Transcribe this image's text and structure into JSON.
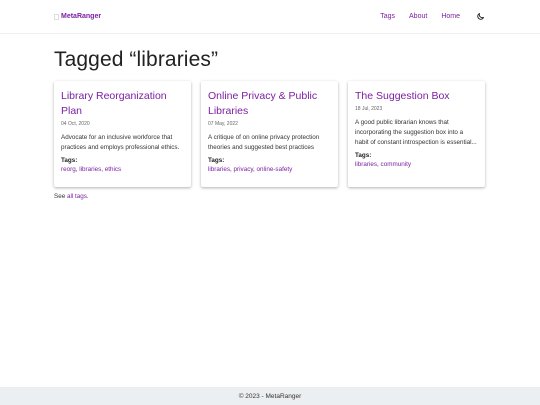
{
  "header": {
    "brand": "MetaRanger",
    "nav": [
      "Tags",
      "About",
      "Home"
    ],
    "theme_icon": "moon-icon"
  },
  "main": {
    "title": "Tagged “libraries”",
    "cards": [
      {
        "title": "Library Reorganization Plan",
        "date": "04 Oct, 2020",
        "summary": "Advocate for an inclusive workforce that practices and employs professional ethics.",
        "tags_label": "Tags:",
        "tags": [
          "reorg",
          "libraries",
          "ethics"
        ]
      },
      {
        "title": "Online Privacy & Public Libraries",
        "date": "07 May, 2022",
        "summary": "A critique of on online privacy protection theories and suggested best practices",
        "tags_label": "Tags:",
        "tags": [
          "libraries",
          "privacy",
          "online-safety"
        ]
      },
      {
        "title": "The Suggestion Box",
        "date": "18 Jul, 2023",
        "summary": "A good public librarian knows that incorporating the suggestion box into a habit of constant introspection is essential...",
        "tags_label": "Tags:",
        "tags": [
          "libraries",
          "community"
        ]
      }
    ],
    "see_all": {
      "prefix": "See",
      "link": "all tags",
      "suffix": "."
    }
  },
  "footer": {
    "text": "© 2023 - MetaRanger"
  }
}
